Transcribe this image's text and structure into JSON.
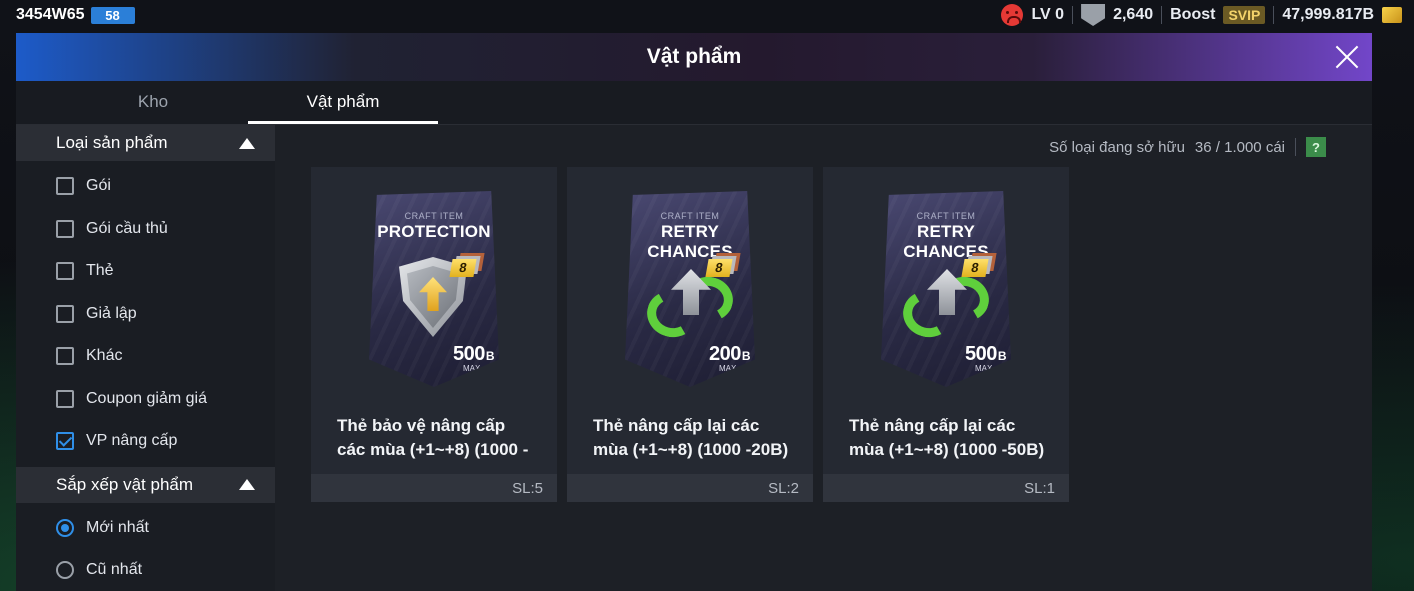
{
  "topbar": {
    "user_id": "3454W65",
    "user_level": "58",
    "lv_label": "LV 0",
    "points": "2,640",
    "boost_label": "Boost",
    "svip_label": "SVIP",
    "balance": "47,999.817B",
    "icons": [
      "sad-face-icon",
      "badge-icon",
      "coin-ticket-icon"
    ]
  },
  "modal": {
    "title": "Vật phẩm",
    "tabs": [
      {
        "label": "Kho",
        "active": false
      },
      {
        "label": "Vật phẩm",
        "active": true
      }
    ]
  },
  "sidebar": {
    "product_type": {
      "title": "Loại sản phẩm",
      "options": [
        {
          "label": "Gói",
          "checked": false
        },
        {
          "label": "Gói cầu thủ",
          "checked": false
        },
        {
          "label": "Thẻ",
          "checked": false
        },
        {
          "label": "Giả lập",
          "checked": false
        },
        {
          "label": "Khác",
          "checked": false
        },
        {
          "label": "Coupon giảm giá",
          "checked": false
        },
        {
          "label": "VP nâng cấp",
          "checked": true
        }
      ]
    },
    "sort": {
      "title": "Sắp xếp vật phẩm",
      "options": [
        {
          "label": "Mới nhất",
          "selected": true
        },
        {
          "label": "Cũ nhất",
          "selected": false
        }
      ]
    }
  },
  "main": {
    "owned_label": "Số loại đang sở hữu",
    "owned_value": "36 / 1.000 cái",
    "help_label": "?",
    "items": [
      {
        "craft_label": "CRAFT ITEM",
        "craft_name": "PROTECTION",
        "icon": "shield-icon",
        "level": "8",
        "price": "500",
        "price_unit": "B",
        "max_label": "MAX",
        "name": "Thẻ bảo vệ nâng cấp các mùa (+1~+8) (1000 -",
        "qty": "SL:5"
      },
      {
        "craft_label": "CRAFT ITEM",
        "craft_name": "RETRY CHANCES",
        "icon": "retry-arrows-icon",
        "level": "8",
        "price": "200",
        "price_unit": "B",
        "max_label": "MAX",
        "name": "Thẻ nâng cấp lại các mùa (+1~+8) (1000 -20B)",
        "qty": "SL:2"
      },
      {
        "craft_label": "CRAFT ITEM",
        "craft_name": "RETRY CHANCES",
        "icon": "retry-arrows-icon",
        "level": "8",
        "price": "500",
        "price_unit": "B",
        "max_label": "MAX",
        "name": "Thẻ nâng cấp lại các mùa (+1~+8) (1000 -50B)",
        "qty": "SL:1"
      }
    ]
  },
  "colors": {
    "accent_blue": "#2f8fe8",
    "svip_gold": "#f3d36b",
    "help_green": "#3b8c4a"
  }
}
